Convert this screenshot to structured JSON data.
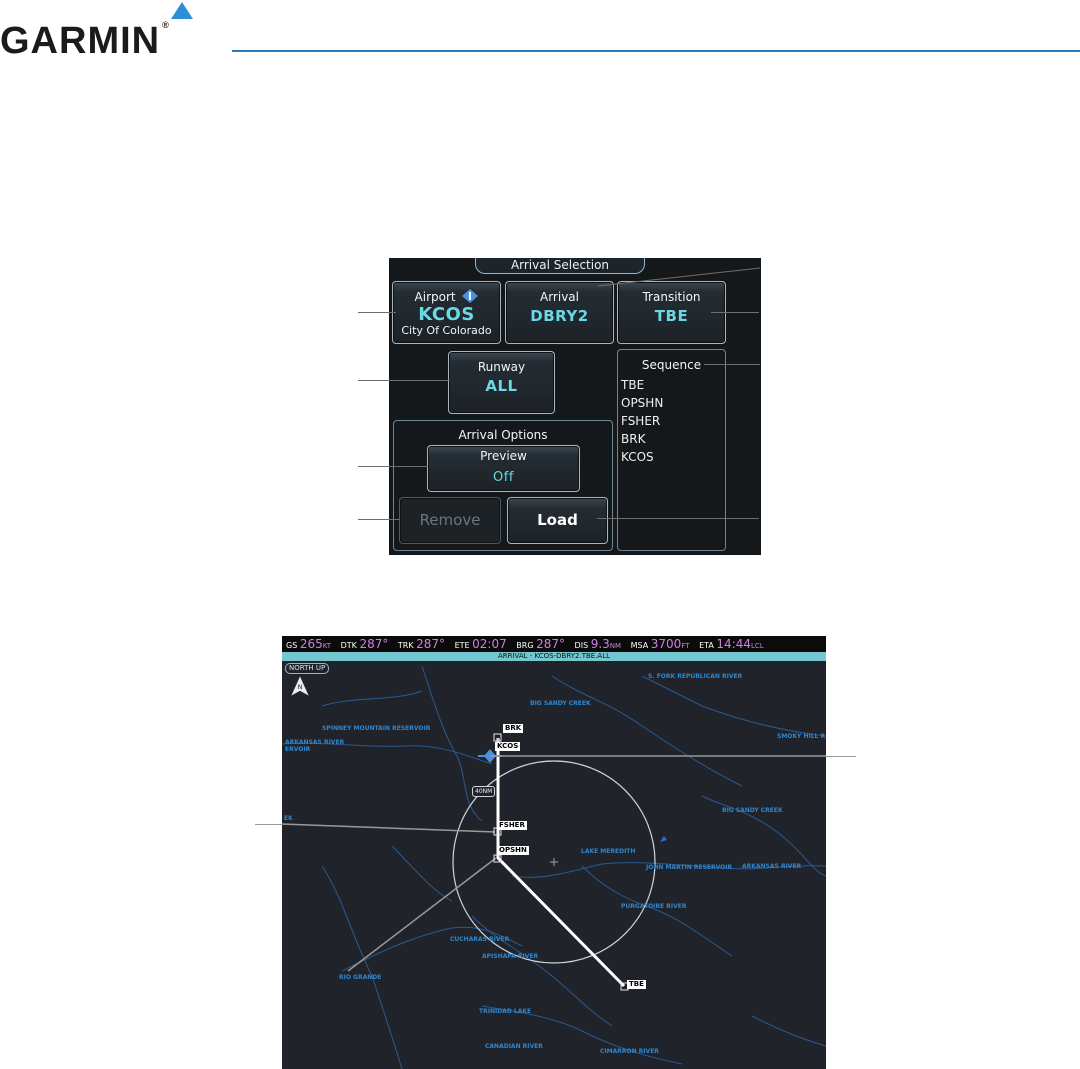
{
  "brand": {
    "name": "GARMIN",
    "reg": "®"
  },
  "panel": {
    "title": "Arrival Selection",
    "airport": {
      "label": "Airport",
      "info_icon": "info-icon",
      "code": "KCOS",
      "name": "City Of Colorado"
    },
    "arrival": {
      "label": "Arrival",
      "value": "DBRY2"
    },
    "transition": {
      "label": "Transition",
      "value": "TBE"
    },
    "runway": {
      "label": "Runway",
      "value": "ALL"
    },
    "sequence": {
      "label": "Sequence",
      "items": [
        "TBE",
        "OPSHN",
        "FSHER",
        "BRK",
        "KCOS"
      ]
    },
    "options": {
      "label": "Arrival Options",
      "preview_label": "Preview",
      "preview_value": "Off"
    },
    "remove_label": "Remove",
    "load_label": "Load"
  },
  "map": {
    "databar": [
      {
        "label": "GS",
        "value": "265",
        "unit": "KT"
      },
      {
        "label": "DTK",
        "value": "287°",
        "unit": ""
      },
      {
        "label": "TRK",
        "value": "287°",
        "unit": ""
      },
      {
        "label": "ETE",
        "value": "02:07",
        "unit": ""
      },
      {
        "label": "BRG",
        "value": "287°",
        "unit": ""
      },
      {
        "label": "DIS",
        "value": "9.3",
        "unit": "NM"
      },
      {
        "label": "MSA",
        "value": "3700",
        "unit": "FT"
      },
      {
        "label": "ETA",
        "value": "14:44",
        "unit": "LCL"
      }
    ],
    "banner": "ARRIVAL - KCOS-DBRY2.TBE.ALL",
    "north_up": "NORTH UP",
    "range": "40NM",
    "waypoints": {
      "brk": "BRK",
      "kcos": "KCOS",
      "fsher": "FSHER",
      "opshn": "OPSHN",
      "tbe": "TBE"
    },
    "rivers": {
      "s_fork": "S. FORK REPUBLICAN RIVER",
      "big_sandy_1": "BIG SANDY CREEK",
      "spinney": "SPINNEY MOUNTAIN RESERVOIR",
      "arkansas_w": "ARKANSAS RIVER",
      "ervoir": "ERVOIR",
      "smoky": "SMOKY HILL R",
      "big_sandy_2": "BIG SANDY CREEK",
      "ek": "EK",
      "meredith": "LAKE MEREDITH",
      "john_martin": "JOHN MARTIN RESERVOIR",
      "arkansas_e": "ARKANSAS RIVER",
      "purgatoire": "PURGATOIRE RIVER",
      "cucharas": "CUCHARAS RIVER",
      "apishapa": "APISHAPA RIVER",
      "rio_grande": "RIO GRANDE",
      "trinidad": "TRINIDAD LAKE",
      "canadian": "CANADIAN RIVER",
      "cimarron": "CIMARRON RIVER"
    }
  }
}
